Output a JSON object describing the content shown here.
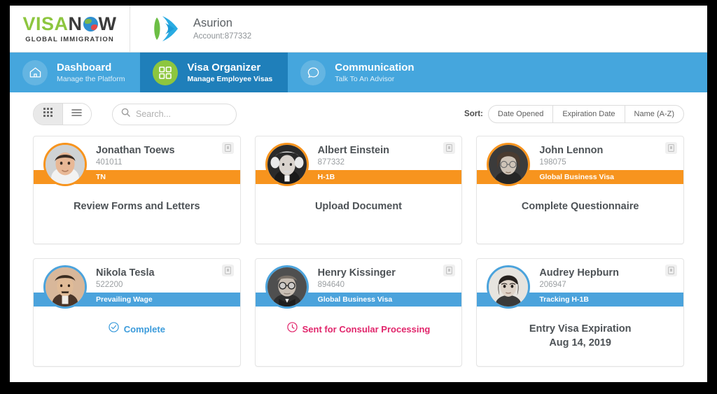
{
  "brand": {
    "word_1": "VISA",
    "word_n": "N",
    "word_w": "W",
    "tagline": "GLOBAL IMMIGRATION",
    "globe_icon": "globe-icon",
    "green": "#8DC63F"
  },
  "account": {
    "logo_icon": "asurion-logo-icon",
    "name": "Asurion",
    "number": "Account:877332"
  },
  "nav": {
    "background": "#45a6dd",
    "active_background": "#1f7fba",
    "items": [
      {
        "title": "Dashboard",
        "subtitle": "Manage the Platform",
        "icon": "home-icon",
        "active": false
      },
      {
        "title": "Visa Organizer",
        "subtitle": "Manage Employee Visas",
        "icon": "grid-icon",
        "active": true
      },
      {
        "title": "Communication",
        "subtitle": "Talk To An Advisor",
        "icon": "chat-bubble-icon",
        "active": false
      }
    ]
  },
  "toolbar": {
    "view_grid_icon": "grid-view-icon",
    "view_list_icon": "list-view-icon",
    "view_active": "grid",
    "search": {
      "icon": "search-icon",
      "placeholder": "Search...",
      "value": ""
    },
    "sort_label": "Sort:",
    "sort_options": [
      "Date Opened",
      "Expiration Date",
      "Name (A-Z)"
    ]
  },
  "colors": {
    "orange": "#F7941E",
    "blue": "#4BA3DC",
    "complete": "#3B9BDB",
    "sent": "#E1256B"
  },
  "cards": [
    {
      "name": "Jonathan Toews",
      "id": "401011",
      "visa_type": "TN",
      "band_color": "#F7941E",
      "accent": "orange",
      "doc_icon": "document-icon",
      "body_type": "task",
      "task": "Review Forms and Letters",
      "avatar_name": "avatar-jonathan-toews"
    },
    {
      "name": "Albert Einstein",
      "id": "877332",
      "visa_type": "H-1B",
      "band_color": "#F7941E",
      "accent": "orange",
      "doc_icon": "document-icon",
      "body_type": "task",
      "task": "Upload Document",
      "avatar_name": "avatar-albert-einstein"
    },
    {
      "name": "John Lennon",
      "id": "198075",
      "visa_type": "Global Business Visa",
      "band_color": "#F7941E",
      "accent": "orange",
      "doc_icon": "document-icon",
      "body_type": "task",
      "task": "Complete Questionnaire",
      "avatar_name": "avatar-john-lennon"
    },
    {
      "name": "Nikola Tesla",
      "id": "522200",
      "visa_type": "Prevailing Wage",
      "band_color": "#4BA3DC",
      "accent": "blue",
      "doc_icon": "document-icon",
      "body_type": "status-complete",
      "status_icon": "check-circle-icon",
      "status": "Complete",
      "avatar_name": "avatar-nikola-tesla"
    },
    {
      "name": "Henry Kissinger",
      "id": "894640",
      "visa_type": "Global Business Visa",
      "band_color": "#4BA3DC",
      "accent": "blue",
      "doc_icon": "document-icon",
      "body_type": "status-sent",
      "status_icon": "clock-icon",
      "status": "Sent for Consular Processing",
      "avatar_name": "avatar-henry-kissinger"
    },
    {
      "name": "Audrey Hepburn",
      "id": "206947",
      "visa_type": "Tracking H-1B",
      "band_color": "#4BA3DC",
      "accent": "blue",
      "doc_icon": "document-icon",
      "body_type": "expiration",
      "task": "Entry Visa Expiration",
      "task_sub": "Aug 14, 2019",
      "avatar_name": "avatar-audrey-hepburn"
    }
  ]
}
